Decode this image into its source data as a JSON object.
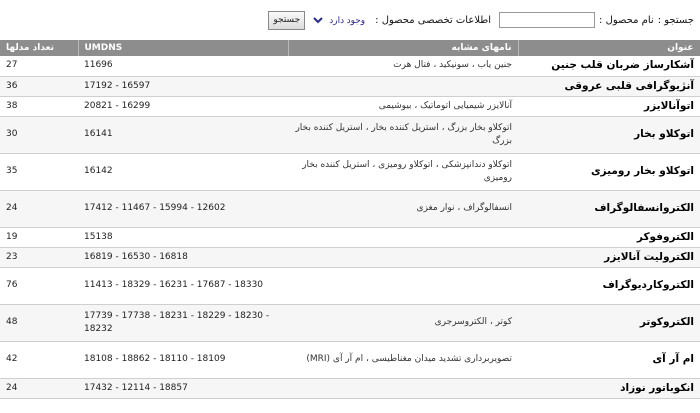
{
  "search": {
    "label": "جستجو :",
    "name_label": "نام محصول :",
    "name_value": "",
    "specs_label": "اطلاعات تخصصی محصول :",
    "availability_selected": "وجود دارد",
    "button_label": "جستجو"
  },
  "table": {
    "headers": {
      "title": "عنوان",
      "similar": "نامهای مشابه",
      "umdns": "UMDNS",
      "count": "تعداد مدلها"
    },
    "rows": [
      {
        "title": "آشکارساز ضربان قلب جنین",
        "similar": "جنین یاب ، سونیکید ، فتال هرت",
        "umdns": "11696",
        "count": "27",
        "height": 20
      },
      {
        "title": "آنژیوگرافی قلبی عروقی",
        "similar": "",
        "umdns": "17192 - 16597",
        "count": "36",
        "height": 20
      },
      {
        "title": "اتوآنالایزر",
        "similar": "آنالایزر شیمیایی اتوماتیک ، بیوشیمی",
        "umdns": "20821 - 16299",
        "count": "38",
        "height": 20
      },
      {
        "title": "اتوکلاو بخار",
        "similar": "اتوکلاو بخار بزرگ ، استریل کننده بخار ، استریل کننده بخار بزرگ",
        "umdns": "16141",
        "count": "30",
        "height": 37
      },
      {
        "title": "اتوکلاو بخار رومیزی",
        "similar": "اتوکلاو دندانپزشکی ، اتوکلاو رومیزی ، استریل کننده بخار رومیزی",
        "umdns": "16142",
        "count": "35",
        "height": 37
      },
      {
        "title": "الکتروانسفالوگراف",
        "similar": "انسفالوگراف ، نوار مغزی",
        "umdns": "17412 - 11467 - 15994 - 12602",
        "count": "24",
        "height": 37
      },
      {
        "title": "الکتروفوکر",
        "similar": "",
        "umdns": "15138",
        "count": "19",
        "height": 20
      },
      {
        "title": "الکترولیت آنالایزر",
        "similar": "",
        "umdns": "16819 - 16530 - 16818",
        "count": "23",
        "height": 20
      },
      {
        "title": "الکتروکاردیوگراف",
        "similar": "",
        "umdns": "11413 - 18329 - 16231 - 17687 - 18330",
        "count": "76",
        "height": 37
      },
      {
        "title": "الکتروکوتر",
        "similar": "کوتر ، الکتروسرجری",
        "umdns": "17739 - 17738 - 18231 - 18229 - 18230 - 18232",
        "count": "48",
        "height": 37
      },
      {
        "title": "ام آر آی",
        "similar": "تصویربرداری تشدید میدان مغناطیسی ، ام آر آی (MRI)",
        "umdns": "18108 - 18862 - 18110 - 18109",
        "count": "42",
        "height": 37
      },
      {
        "title": "انکوباتور نوزاد",
        "similar": "",
        "umdns": "17432 - 12114 - 18857",
        "count": "24",
        "height": 20
      }
    ]
  },
  "colors": {
    "header_bg": "#8d8d8d",
    "header_text": "#ffffff",
    "row_border": "#cfcfcf",
    "select_text": "#2a2a8a"
  }
}
